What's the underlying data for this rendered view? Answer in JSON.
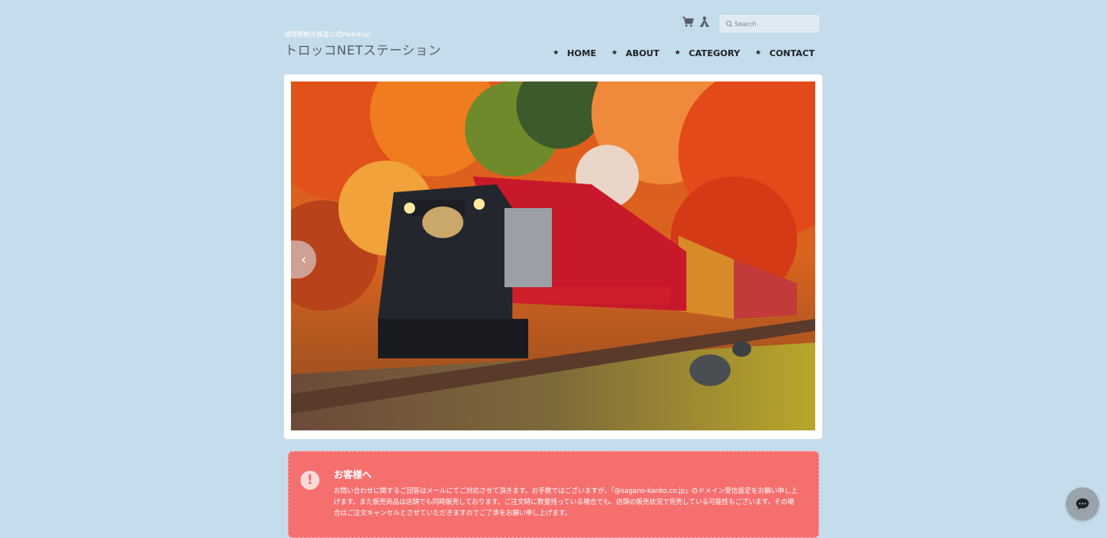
{
  "header": {
    "tagline": "嵯峨野観光鉄道公式Webshop",
    "logo": "トロッコNETステーション"
  },
  "icons": {
    "cart": "cart-icon",
    "account": "account-icon",
    "search": "search-icon",
    "chat": "chat-icon"
  },
  "search": {
    "placeholder": "Search"
  },
  "nav": {
    "items": [
      {
        "label": "HOME"
      },
      {
        "label": "ABOUT"
      },
      {
        "label": "CATEGORY"
      },
      {
        "label": "CONTACT"
      }
    ]
  },
  "slider": {
    "prev_glyph": "‹"
  },
  "notice": {
    "title": "お客様へ",
    "body": "お問い合わせに関するご回答はメールにてご対応させて頂きます。お手数ではございますが、「@sagano-kanko.co.jp」のドメイン受信設定をお願い申し上げます。また販売商品は店頭でも同時販売しております。ご注文時に数量残っている場合でも、店頭の販売状況で完売している可能性もございます。その場合はご注文キャンセルとさせていただきますのでご了承をお願い申し上げます。",
    "icon_glyph": "!"
  },
  "colors": {
    "background": "#c5dcec",
    "notice": "#f56f6f",
    "text_dark": "#1d2226"
  }
}
